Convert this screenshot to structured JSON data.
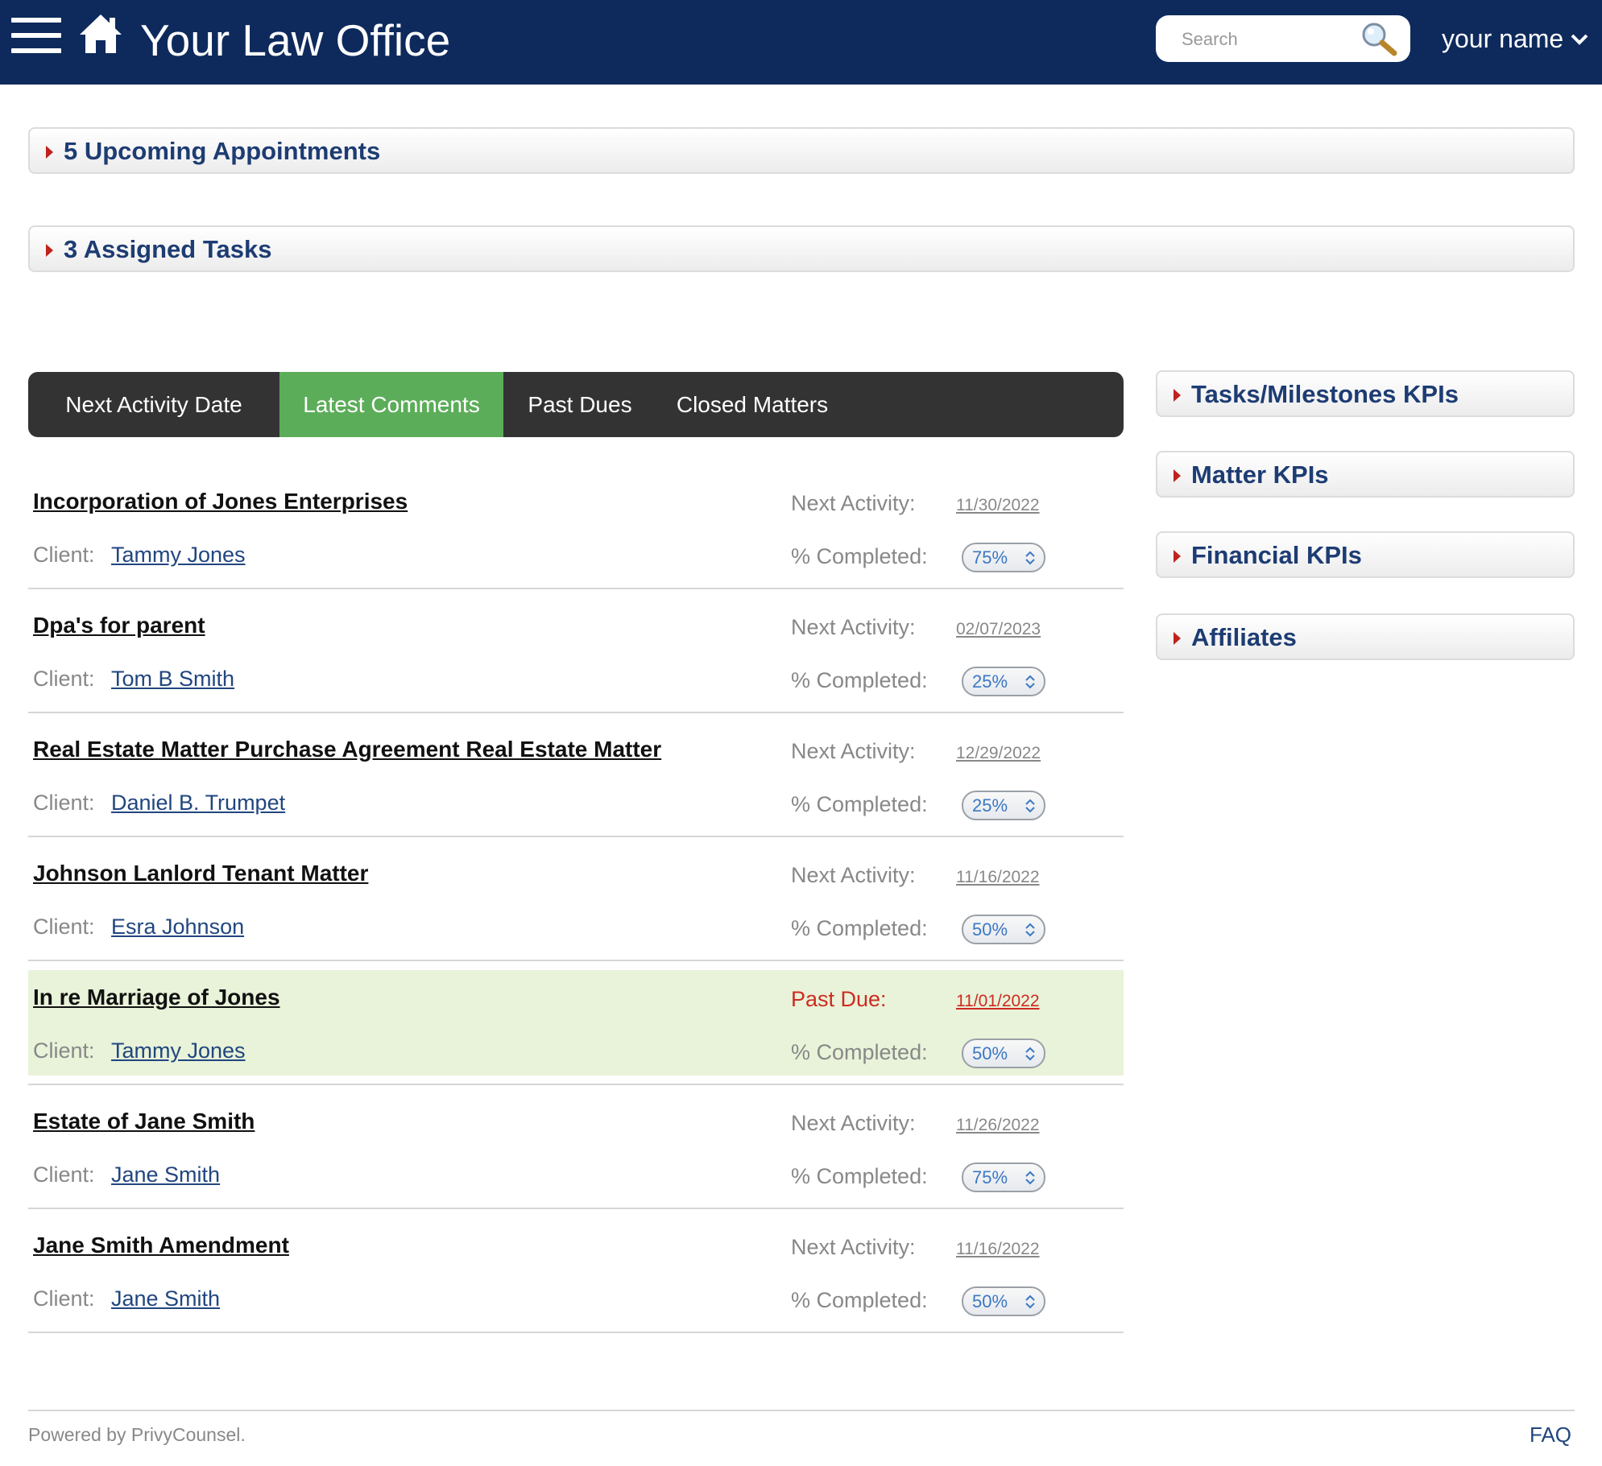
{
  "header": {
    "app_title": "Your Law Office",
    "search_placeholder": "Search",
    "user_name": "your name"
  },
  "panels": {
    "appointments": "5 Upcoming Appointments",
    "tasks": "3 Assigned Tasks"
  },
  "tabs": [
    {
      "label": "Next Activity Date",
      "active": false
    },
    {
      "label": "Latest Comments",
      "active": true
    },
    {
      "label": "Past Dues",
      "active": false
    },
    {
      "label": "Closed Matters",
      "active": false
    }
  ],
  "labels": {
    "client": "Client:",
    "next_activity": "Next Activity:",
    "past_due": "Past Due:",
    "completed": "% Completed:"
  },
  "matters": [
    {
      "title": "Incorporation of Jones Enterprises",
      "client": "Tammy Jones",
      "date": "11/30/2022",
      "completed": "75%",
      "past_due": false
    },
    {
      "title": "Dpa's for parent",
      "client": "Tom B Smith",
      "date": "02/07/2023",
      "completed": "25%",
      "past_due": false
    },
    {
      "title": "Real Estate Matter Purchase Agreement Real Estate Matter",
      "client": "Daniel B. Trumpet",
      "date": "12/29/2022",
      "completed": "25%",
      "past_due": false
    },
    {
      "title": "Johnson Lanlord Tenant Matter",
      "client": "Esra Johnson",
      "date": "11/16/2022",
      "completed": "50%",
      "past_due": false
    },
    {
      "title": "In re Marriage of Jones",
      "client": "Tammy Jones",
      "date": "11/01/2022",
      "completed": "50%",
      "past_due": true
    },
    {
      "title": "Estate of Jane Smith",
      "client": "Jane Smith",
      "date": "11/26/2022",
      "completed": "75%",
      "past_due": false
    },
    {
      "title": "Jane Smith Amendment",
      "client": "Jane Smith",
      "date": "11/16/2022",
      "completed": "50%",
      "past_due": false
    }
  ],
  "side_panels": {
    "tasks_kpis": "Tasks/Milestones KPIs",
    "matter_kpis": "Matter KPIs",
    "financial_kpis": "Financial KPIs",
    "affiliates": "Affiliates"
  },
  "footer": {
    "powered_by": "Powered by PrivyCounsel.",
    "faq": "FAQ"
  },
  "colors": {
    "header_bg": "#0e2a5c",
    "active_tab": "#5cad59",
    "tab_bar": "#333333",
    "highlight_row": "#e8f3d9",
    "past_due": "#cf2b22",
    "link": "#21467f"
  }
}
